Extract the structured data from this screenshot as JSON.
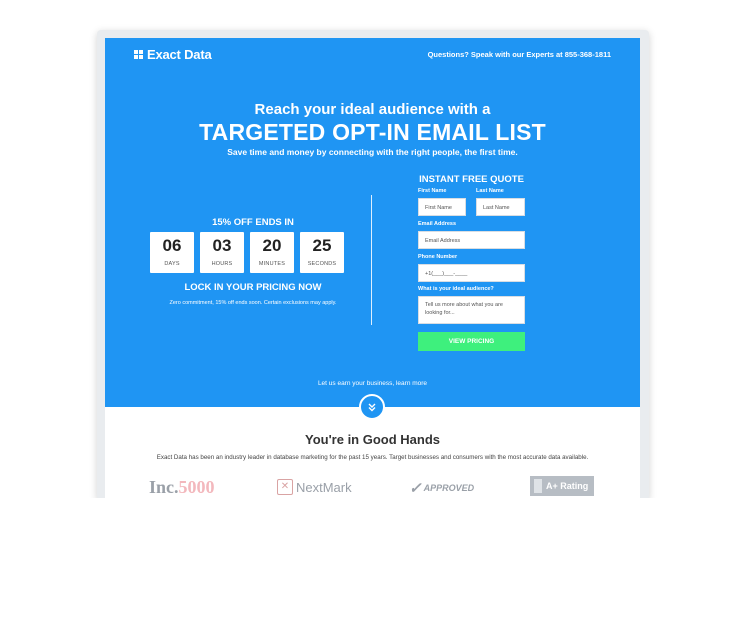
{
  "brand": {
    "name": "Exact Data"
  },
  "header": {
    "contact": "Questions? Speak with our Experts at 855-368-1811"
  },
  "hero": {
    "line1": "Reach your ideal audience with a",
    "line2": "TARGETED OPT-IN EMAIL LIST",
    "line3": "Save time and money by connecting with the right people, the first time."
  },
  "countdown": {
    "offer": "15% OFF ENDS IN",
    "units": [
      {
        "value": "06",
        "label": "DAYS"
      },
      {
        "value": "03",
        "label": "HOURS"
      },
      {
        "value": "20",
        "label": "MINUTES"
      },
      {
        "value": "25",
        "label": "SECONDS"
      }
    ],
    "lock": "LOCK IN YOUR PRICING NOW",
    "fine_print": "Zero commitment, 15% off ends soon. Certain exclusions may apply."
  },
  "quote_form": {
    "title": "INSTANT FREE QUOTE",
    "first_name": {
      "label": "First Name",
      "placeholder": "First Name"
    },
    "last_name": {
      "label": "Last Name",
      "placeholder": "Last Name"
    },
    "email": {
      "label": "Email Address",
      "placeholder": "Email Address"
    },
    "phone": {
      "label": "Phone Number",
      "placeholder": "+1(___)___-____"
    },
    "audience": {
      "label": "What is your ideal audience?",
      "placeholder": "Tell us more about what you are looking for..."
    },
    "submit": "VIEW PRICING"
  },
  "earn_text": "Let us earn your business, learn more",
  "trust": {
    "title": "You're in Good Hands",
    "text": "Exact Data has been an industry leader in database marketing for the past 15 years. Target businesses and consumers with the most accurate data available.",
    "logos": {
      "inc_prefix": "Inc.",
      "inc_suffix": "5000",
      "nextmark": "NextMark",
      "approved": "APPROVED",
      "bbb_rating": "A+ Rating"
    }
  },
  "colors": {
    "hero_bg": "#1f95f3",
    "cta_bg": "#3ef07d"
  }
}
